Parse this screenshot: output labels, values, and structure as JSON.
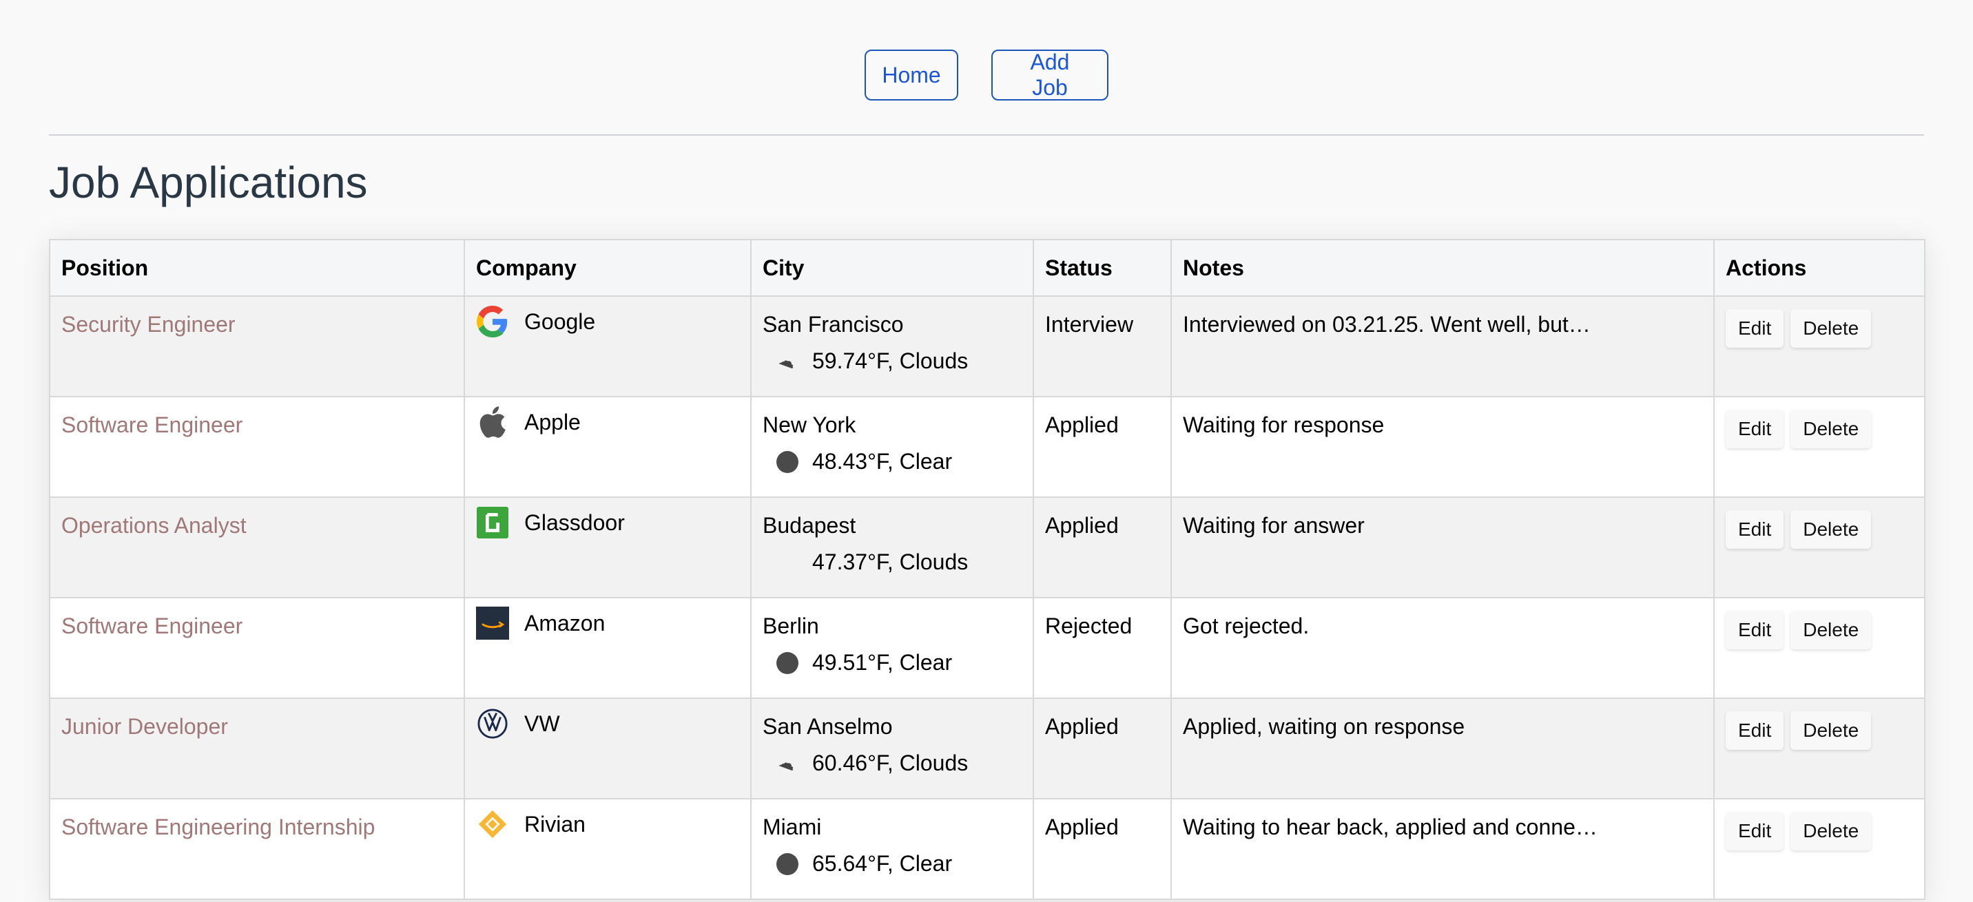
{
  "nav": {
    "home_label": "Home",
    "add_job_label": "Add Job"
  },
  "page_title": "Job Applications",
  "table": {
    "headers": [
      "Position",
      "Company",
      "City",
      "Status",
      "Notes",
      "Actions"
    ],
    "actions": {
      "edit_label": "Edit",
      "delete_label": "Delete"
    },
    "rows": [
      {
        "position": "Security Engineer",
        "company": "Google",
        "logo": "google-logo",
        "city": "San Francisco",
        "weather_icon": "clouds-icon",
        "weather": "59.74°F, Clouds",
        "status": "Interview",
        "notes": "Interviewed on 03.21.25. Went well, but…"
      },
      {
        "position": "Software Engineer",
        "company": "Apple",
        "logo": "apple-logo",
        "city": "New York",
        "weather_icon": "clear-icon",
        "weather": "48.43°F, Clear",
        "status": "Applied",
        "notes": "Waiting for response"
      },
      {
        "position": "Operations Analyst",
        "company": "Glassdoor",
        "logo": "glassdoor-logo",
        "city": "Budapest",
        "weather_icon": "none",
        "weather": "47.37°F, Clouds",
        "status": "Applied",
        "notes": "Waiting for answer"
      },
      {
        "position": "Software Engineer",
        "company": "Amazon",
        "logo": "amazon-logo",
        "city": "Berlin",
        "weather_icon": "clear-icon",
        "weather": "49.51°F, Clear",
        "status": "Rejected",
        "notes": "Got rejected."
      },
      {
        "position": "Junior Developer",
        "company": "VW",
        "logo": "vw-logo",
        "city": "San Anselmo",
        "weather_icon": "clouds-icon",
        "weather": "60.46°F, Clouds",
        "status": "Applied",
        "notes": "Applied, waiting on response"
      },
      {
        "position": "Software Engineering Internship",
        "company": "Rivian",
        "logo": "rivian-logo",
        "city": "Miami",
        "weather_icon": "clear-icon",
        "weather": "65.64°F, Clear",
        "status": "Applied",
        "notes": "Waiting to hear back, applied and conne…"
      }
    ]
  },
  "colors": {
    "link": "#1a56d8",
    "position_text": "#a07878",
    "title": "#2a3744"
  }
}
